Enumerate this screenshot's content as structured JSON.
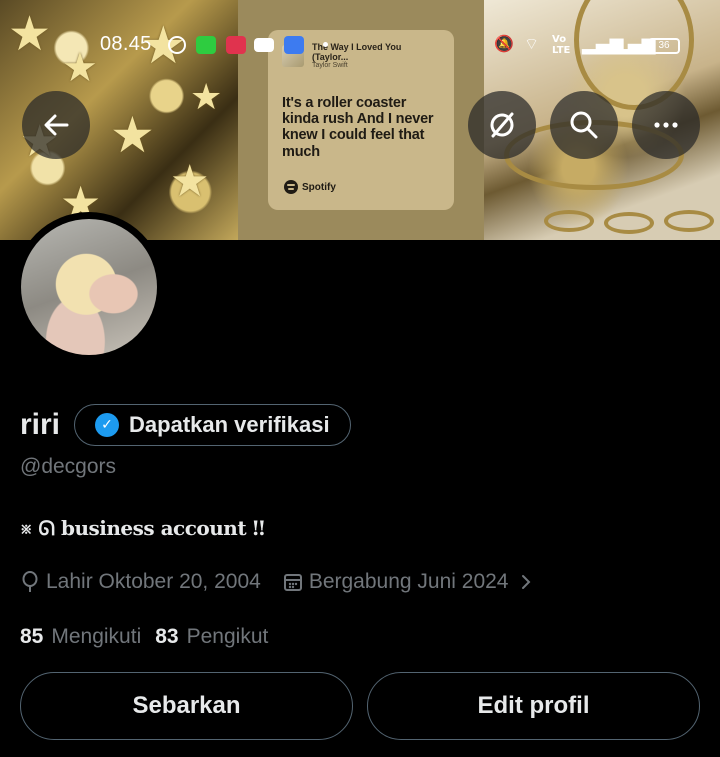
{
  "status_bar": {
    "time": "08.45",
    "battery": "36",
    "network_label": "Vo LTE"
  },
  "banner": {
    "song_title": "The Way I Loved You (Taylor...",
    "song_artist": "Taylor Swift",
    "lyrics": "It's a roller coaster kinda rush And I never knew I could feel that much",
    "spotify_label": "Spotify"
  },
  "header_actions": {
    "back": "back-arrow-icon",
    "quick": "quick-action-icon",
    "search": "search-icon",
    "more": "more-icon"
  },
  "profile": {
    "display_name": "riri",
    "verify_label": "Dapatkan verifikasi",
    "handle": "@decgors",
    "bio": "※ ᘏ business account ‼",
    "birth": "Lahir Oktober 20, 2004",
    "joined": "Bergabung Juni 2024",
    "following_count": "85",
    "following_label": "Mengikuti",
    "followers_count": "83",
    "followers_label": "Pengikut"
  },
  "actions": {
    "share_label": "Sebarkan",
    "edit_label": "Edit profil"
  },
  "colors": {
    "background": "#000000",
    "text": "#e7e9ea",
    "muted": "#71767b",
    "border": "#536471",
    "verified_blue": "#1d9bf0"
  }
}
